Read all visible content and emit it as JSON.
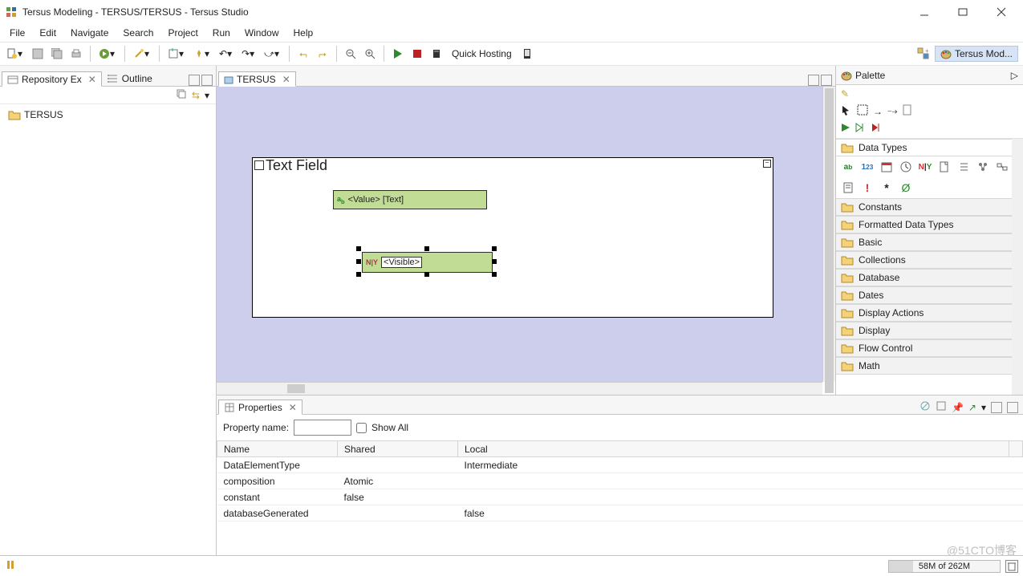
{
  "window": {
    "title": "Tersus Modeling - TERSUS/TERSUS - Tersus Studio"
  },
  "menu": {
    "items": [
      "File",
      "Edit",
      "Navigate",
      "Search",
      "Project",
      "Run",
      "Window",
      "Help"
    ]
  },
  "toolbar": {
    "quick_hosting": "Quick Hosting",
    "perspective_label": "Tersus Mod..."
  },
  "left": {
    "repo_tab": "Repository Ex",
    "outline_tab": "Outline",
    "tree_root": "TERSUS"
  },
  "editor": {
    "tab": "TERSUS",
    "model_title": "Text Field",
    "slot_value": "<Value> [Text]",
    "slot_visible": "<Visible>"
  },
  "palette": {
    "title": "Palette",
    "drawers": [
      "Data Types",
      "Constants",
      "Formatted Data Types",
      "Basic",
      "Collections",
      "Database",
      "Dates",
      "Display Actions",
      "Display",
      "Flow Control",
      "Math"
    ],
    "type_icons": [
      "a_b",
      "1_23",
      "date-grid-icon",
      "clock-icon",
      "ny-icon",
      "doc-icon",
      "list-icon",
      "tree-icon",
      "flow-icon"
    ],
    "type_icons2": [
      "page-icon",
      "exclaim-red",
      "asterisk",
      "leaf-green"
    ]
  },
  "properties": {
    "tab": "Properties",
    "filter_label": "Property name:",
    "showall": "Show All",
    "columns": [
      "Name",
      "Shared",
      "Local"
    ],
    "rows": [
      {
        "name": "DataElementType",
        "shared": "",
        "local": "Intermediate"
      },
      {
        "name": "composition",
        "shared": "Atomic",
        "local": ""
      },
      {
        "name": "constant",
        "shared": "false",
        "local": ""
      },
      {
        "name": "databaseGenerated",
        "shared": "",
        "local": "false"
      }
    ]
  },
  "status": {
    "memory": "58M of 262M"
  },
  "watermark": "@51CTO博客"
}
